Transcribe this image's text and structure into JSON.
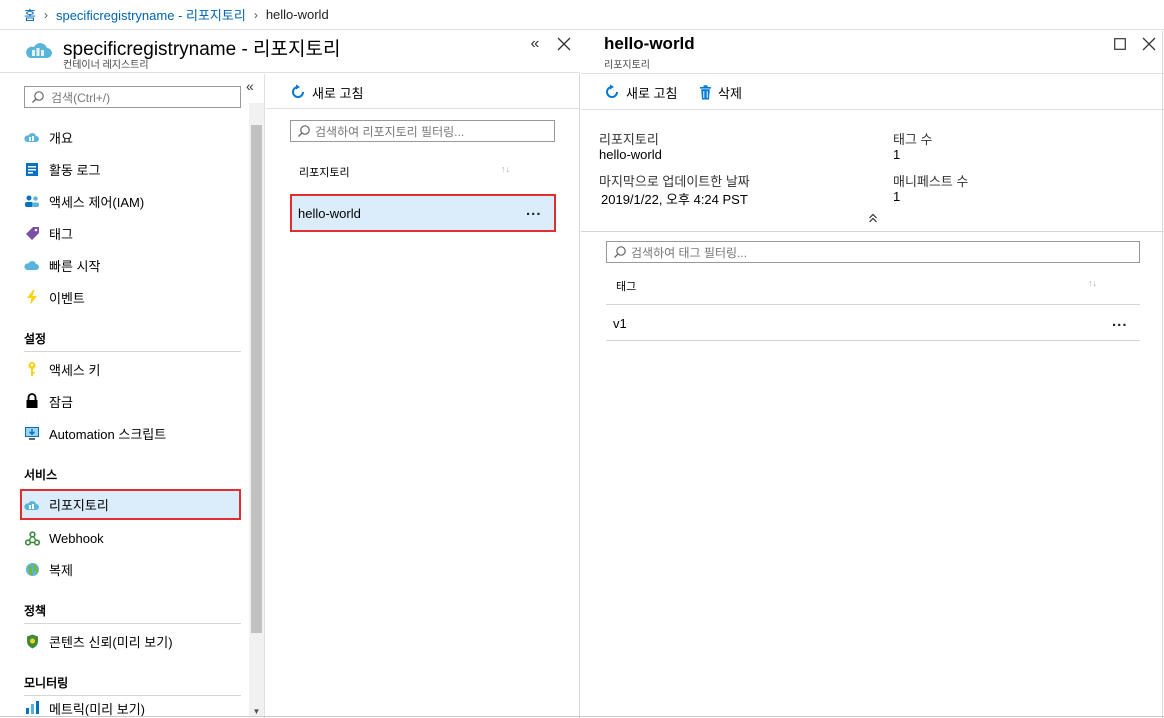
{
  "breadcrumb": {
    "home": "홈",
    "registry": "specificregistryname - 리포지토리",
    "current": "hello-world"
  },
  "left_blade": {
    "title": "specificregistryname - 리포지토리",
    "subtitle": "컨테이너 레지스트리",
    "search_placeholder": "검색(Ctrl+/)",
    "collapse_label": "«"
  },
  "sidebar": {
    "items": [
      {
        "label": "개요",
        "icon": "cloud-icon"
      },
      {
        "label": "활동 로그",
        "icon": "activity-log-icon"
      },
      {
        "label": "액세스 제어(IAM)",
        "icon": "people-icon"
      },
      {
        "label": "태그",
        "icon": "tag-icon"
      },
      {
        "label": "빠른 시작",
        "icon": "quickstart-cloud-icon"
      },
      {
        "label": "이벤트",
        "icon": "lightning-icon"
      }
    ],
    "sections": [
      {
        "label": "설정",
        "items": [
          {
            "label": "액세스 키",
            "icon": "key-icon"
          },
          {
            "label": "잠금",
            "icon": "lock-icon"
          },
          {
            "label": "Automation 스크립트",
            "icon": "monitor-download-icon"
          }
        ]
      },
      {
        "label": "서비스",
        "items": [
          {
            "label": "리포지토리",
            "icon": "repository-icon",
            "selected": true
          },
          {
            "label": "Webhook",
            "icon": "webhook-icon"
          },
          {
            "label": "복제",
            "icon": "globe-icon"
          }
        ]
      },
      {
        "label": "정책",
        "items": [
          {
            "label": "콘텐츠 신뢰(미리 보기)",
            "icon": "shield-icon"
          }
        ]
      },
      {
        "label": "모니터링",
        "items": [
          {
            "label": "메트릭(미리 보기)",
            "icon": "metrics-icon"
          }
        ]
      }
    ]
  },
  "mid_panel": {
    "refresh_label": "새로 고침",
    "filter_placeholder": "검색하여 리포지토리 필터링...",
    "column_header": "리포지토리",
    "rows": [
      {
        "name": "hello-world",
        "more": "..."
      }
    ]
  },
  "right_panel": {
    "title": "hello-world",
    "subtitle": "리포지토리",
    "toolbar": {
      "refresh_label": "새로 고침",
      "delete_label": "삭제"
    },
    "essentials": {
      "repository_label": "리포지토리",
      "repository_value": "hello-world",
      "tag_count_label": "태그 수",
      "tag_count_value": "1",
      "last_updated_label": "마지막으로 업데이트한 날짜",
      "last_updated_value": "2019/1/22, 오후 4:24 PST",
      "manifest_count_label": "매니페스트 수",
      "manifest_count_value": "1"
    },
    "tag_filter_placeholder": "검색하여 태그 필터링...",
    "tag_column_header": "태그",
    "tags": [
      {
        "name": "v1",
        "more": "..."
      }
    ]
  },
  "colors": {
    "link": "#0063b1",
    "selected_bg": "#dbecfa",
    "highlight_border": "#e02d2d",
    "azure_blue": "#0078d4"
  }
}
